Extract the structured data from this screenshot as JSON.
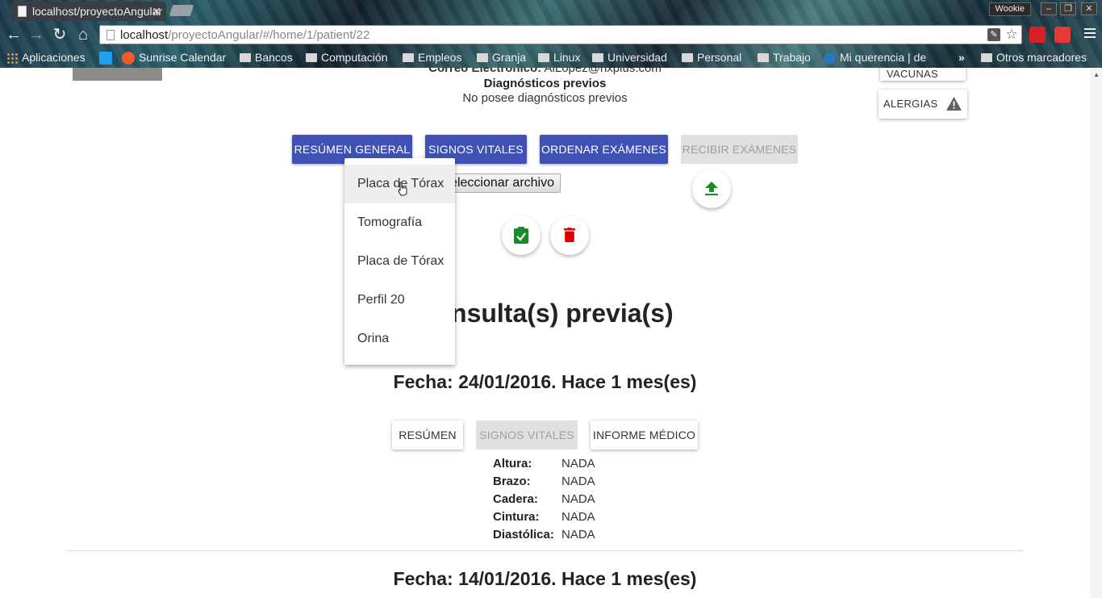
{
  "browser": {
    "tab_title": "localhost/proyectoAngular",
    "profile_name": "Wookie",
    "url_host": "localhost",
    "url_path": "/proyectoAngular/#/home/1/patient/22",
    "bookmarks": [
      {
        "label": "Aplicaciones",
        "icon": "apps-grid-icon"
      },
      {
        "label": "",
        "icon": "twitter-icon"
      },
      {
        "label": "Sunrise Calendar",
        "icon": "sunrise-icon"
      },
      {
        "label": "Bancos",
        "icon": "folder-icon"
      },
      {
        "label": "Computación",
        "icon": "folder-icon"
      },
      {
        "label": "Empleos",
        "icon": "folder-icon"
      },
      {
        "label": "Granja",
        "icon": "folder-icon"
      },
      {
        "label": "Linux",
        "icon": "folder-icon"
      },
      {
        "label": "Universidad",
        "icon": "folder-icon"
      },
      {
        "label": "Personal",
        "icon": "folder-icon"
      },
      {
        "label": "Trabajo",
        "icon": "folder-icon"
      },
      {
        "label": "Mi querencia | de",
        "icon": "wordpress-icon"
      }
    ],
    "other_bookmarks": "Otros marcadores",
    "overflow_glyph": "»"
  },
  "patient": {
    "email_label": "Correo Electrónico:",
    "email_value": "AlLopez@hxplus.com",
    "prev_diag_title": "Diagnósticos previos",
    "prev_diag_value": "No posee diagnósticos previos",
    "side_top_button": "VACUNAS",
    "allergies_button": "ALERGIAS"
  },
  "tabs": [
    {
      "label": "RESÚMEN GENERAL",
      "disabled": false
    },
    {
      "label": "SIGNOS VITALES",
      "disabled": false
    },
    {
      "label": "ORDENAR EXÁMENES",
      "disabled": false
    },
    {
      "label": "RECIBIR EXÁMENES",
      "disabled": true
    }
  ],
  "file_button": "Seleccionar archivo",
  "exam_menu": {
    "items": [
      "Placa de Tórax",
      "Tomografía",
      "Placa de Tórax",
      "Perfil 20",
      "Orina"
    ],
    "hovered_index": 0
  },
  "consultations": {
    "title": "Consulta(s) previa(s)",
    "entries": [
      {
        "date_heading": "Fecha: 24/01/2016. Hace 1 mes(es)",
        "buttons": [
          {
            "label": "RESÚMEN",
            "disabled": false
          },
          {
            "label": "SIGNOS VITALES",
            "disabled": true
          },
          {
            "label": "INFORME MÉDICO",
            "disabled": false
          }
        ],
        "vitals": [
          {
            "label": "Altura:",
            "value": "NADA"
          },
          {
            "label": "Brazo:",
            "value": "NADA"
          },
          {
            "label": "Cadera:",
            "value": "NADA"
          },
          {
            "label": "Cintura:",
            "value": "NADA"
          },
          {
            "label": "Diastólica:",
            "value": "NADA"
          }
        ]
      },
      {
        "date_heading": "Fecha: 14/01/2016. Hace 1 mes(es)"
      }
    ]
  },
  "colors": {
    "primary": "#3f51b5",
    "success": "#1b8a2a",
    "danger": "#e00000",
    "disabled_bg": "#e0e0e0"
  }
}
